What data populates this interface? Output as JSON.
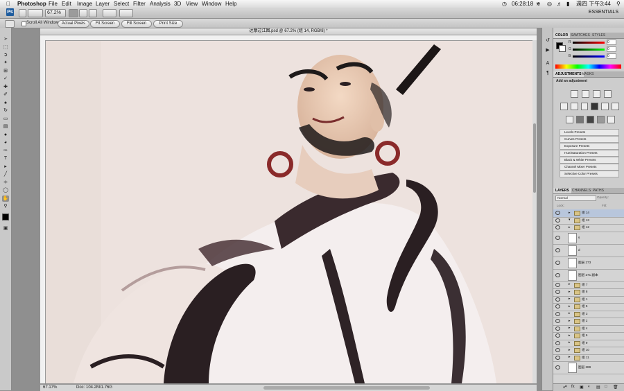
{
  "menubar": {
    "app_name": "Photoshop",
    "menus": [
      "File",
      "Edit",
      "Image",
      "Layer",
      "Select",
      "Filter",
      "Analysis",
      "3D",
      "View",
      "Window",
      "Help"
    ],
    "time_display": "06:28:18",
    "day_time": "週四 下午3:44"
  },
  "appbar": {
    "zoom": "67.2%",
    "workspace": "ESSENTIALS"
  },
  "options": {
    "scroll_all_windows": "Scroll All Windows",
    "buttons": [
      "Actual Pixels",
      "Fit Screen",
      "Fill Screen",
      "Print Size"
    ]
  },
  "document": {
    "tab_title": "达摩过江图.psd @ 67.2% (组 14, RGB/8) *",
    "status_zoom": "67.17%",
    "doc_size": "Doc: 104.2M/1.76G"
  },
  "color_panel": {
    "tabs": [
      "COLOR",
      "SWATCHES",
      "STYLES"
    ],
    "channels": [
      {
        "label": "R",
        "value": "0"
      },
      {
        "label": "G",
        "value": "0"
      },
      {
        "label": "B",
        "value": "0"
      }
    ]
  },
  "adjustments_panel": {
    "tabs": [
      "ADJUSTMENTS",
      "MASKS"
    ],
    "heading": "Add an adjustment",
    "presets": [
      "Levels Presets",
      "Curves Presets",
      "Exposure Presets",
      "Hue/Saturation Presets",
      "Black & White Presets",
      "Channel Mixer Presets",
      "Selective Color Presets"
    ]
  },
  "layers_panel": {
    "tabs": [
      "LAYERS",
      "CHANNELS",
      "PATHS"
    ],
    "blend_mode": "Normal",
    "opacity_label": "Opacity:",
    "lock_label": "Lock:",
    "fill_label": "Fill:",
    "layers": [
      {
        "name": "组 14",
        "kind": "group"
      },
      {
        "name": "组 13",
        "kind": "group-open"
      },
      {
        "name": "组 12",
        "kind": "group"
      },
      {
        "name": "s",
        "kind": "layer"
      },
      {
        "name": "d",
        "kind": "layer"
      },
      {
        "name": "图层 273",
        "kind": "layer"
      },
      {
        "name": "图层 271 副本",
        "kind": "layer"
      },
      {
        "name": "组 7",
        "kind": "group"
      },
      {
        "name": "组 8",
        "kind": "group"
      },
      {
        "name": "组 1",
        "kind": "group"
      },
      {
        "name": "组 5",
        "kind": "group"
      },
      {
        "name": "组 3",
        "kind": "group"
      },
      {
        "name": "组 2",
        "kind": "group"
      },
      {
        "name": "组 4",
        "kind": "group"
      },
      {
        "name": "组 6",
        "kind": "group"
      },
      {
        "name": "组 9",
        "kind": "group"
      },
      {
        "name": "组 10",
        "kind": "group"
      },
      {
        "name": "组 11",
        "kind": "group"
      },
      {
        "name": "图层 289",
        "kind": "layer"
      }
    ]
  },
  "colors": {
    "canvas_bg": "#ede2de",
    "robe_ink": "#2a1f22",
    "earring": "#8a2a2a"
  }
}
